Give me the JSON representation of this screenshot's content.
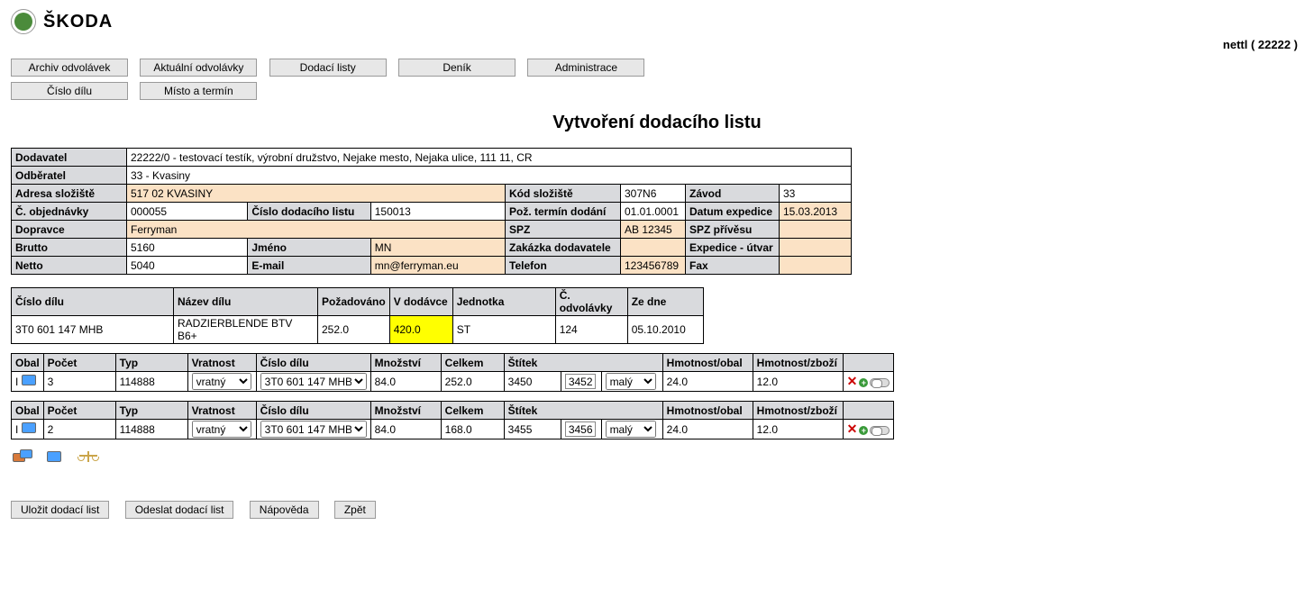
{
  "brand": "ŠKODA",
  "user_display": "nettl ( 22222 )",
  "nav1": {
    "archive": "Archiv odvolávek",
    "current": "Aktuální odvolávky",
    "delivery": "Dodací listy",
    "diary": "Deník",
    "admin": "Administrace"
  },
  "nav2": {
    "part_no": "Číslo dílu",
    "place_date": "Místo a termín"
  },
  "page_title": "Vytvoření dodacího listu",
  "info": {
    "labels": {
      "supplier": "Dodavatel",
      "customer": "Odběratel",
      "warehouse_addr": "Adresa složiště",
      "warehouse_code": "Kód složiště",
      "plant": "Závod",
      "order_no": "Č. objednávky",
      "dn_no": "Číslo dodacího listu",
      "req_date": "Pož. termín dodání",
      "ship_date": "Datum expedice",
      "carrier": "Dopravce",
      "spz": "SPZ",
      "trailer_spz": "SPZ přívěsu",
      "brutto": "Brutto",
      "name": "Jméno",
      "supplier_order": "Zakázka dodavatele",
      "ship_dept": "Expedice - útvar",
      "netto": "Netto",
      "email": "E-mail",
      "phone": "Telefon",
      "fax": "Fax"
    },
    "supplier": "22222/0  -  testovací testík, výrobní družstvo,   Nejake mesto,   Nejaka ulice,   111 11,   CR",
    "customer": "33 - Kvasiny",
    "warehouse_addr": "517 02 KVASINY",
    "warehouse_code": "307N6",
    "plant": "33",
    "order_no": "000055",
    "dn_no": "150013",
    "req_date": "01.01.0001",
    "ship_date": "15.03.2013",
    "carrier": "Ferryman",
    "spz": "AB 12345",
    "trailer_spz": "",
    "brutto": "5160",
    "name": "MN",
    "supplier_order": "",
    "ship_dept": "",
    "netto": "5040",
    "email": "mn@ferryman.eu",
    "phone": "123456789",
    "fax": ""
  },
  "part_table": {
    "headers": {
      "part_no": "Číslo dílu",
      "part_name": "Název dílu",
      "requested": "Požadováno",
      "in_delivery": "V dodávce",
      "unit": "Jednotka",
      "call_no": "Č. odvolávky",
      "from_date": "Ze dne"
    },
    "row": {
      "part_no": "3T0 601 147    MHB",
      "part_name": "RADZIERBLENDE BTV B6+",
      "requested": "252.0",
      "in_delivery": "420.0",
      "unit": "ST",
      "call_no": "124",
      "from_date": "05.10.2010"
    }
  },
  "pack_headers": {
    "obal": "Obal",
    "pocet": "Počet",
    "typ": "Typ",
    "vratnost": "Vratnost",
    "cislo_dilu": "Číslo dílu",
    "mnozstvi": "Množství",
    "celkem": "Celkem",
    "stitek": "Štítek",
    "hm_obal": "Hmotnost/obal",
    "hm_zbozi": "Hmotnost/zboží"
  },
  "pack1": {
    "level": "I",
    "pocet": "3",
    "typ": "114888",
    "vratnost": "vratný",
    "cislo_dilu": "3T0 601 147 MHB",
    "mnozstvi": "84.0",
    "celkem": "252.0",
    "stitek_a": "3450",
    "stitek_b": "3452",
    "stitek_size": "malý",
    "hm_obal": "24.0",
    "hm_zbozi": "12.0"
  },
  "pack2": {
    "level": "I",
    "pocet": "2",
    "typ": "114888",
    "vratnost": "vratný",
    "cislo_dilu": "3T0 601 147 MHB",
    "mnozstvi": "84.0",
    "celkem": "168.0",
    "stitek_a": "3455",
    "stitek_b": "3456",
    "stitek_size": "malý",
    "hm_obal": "24.0",
    "hm_zbozi": "12.0"
  },
  "buttons": {
    "save": "Uložit dodací list",
    "send": "Odeslat dodací list",
    "help": "Nápověda",
    "back": "Zpět"
  }
}
